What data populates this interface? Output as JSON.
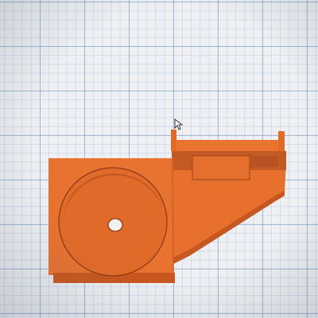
{
  "app": {
    "view": "3d-workplane"
  },
  "colors": {
    "workplane_bg": "#eef0f3",
    "grid_major": "#7896be",
    "grid_minor": "#96aac8",
    "part_face": "#e8722f",
    "part_shadow": "#c85a22",
    "part_dark": "#b24d1c",
    "part_highlight": "#f08a45"
  },
  "scene": {
    "object": "orange-part",
    "features": [
      "square-base-plate",
      "circular-recess",
      "center-hole",
      "angled-bracket",
      "top-rail",
      "rectangular-slot"
    ]
  },
  "cursor": {
    "icon": "mouse-pointer-icon"
  }
}
